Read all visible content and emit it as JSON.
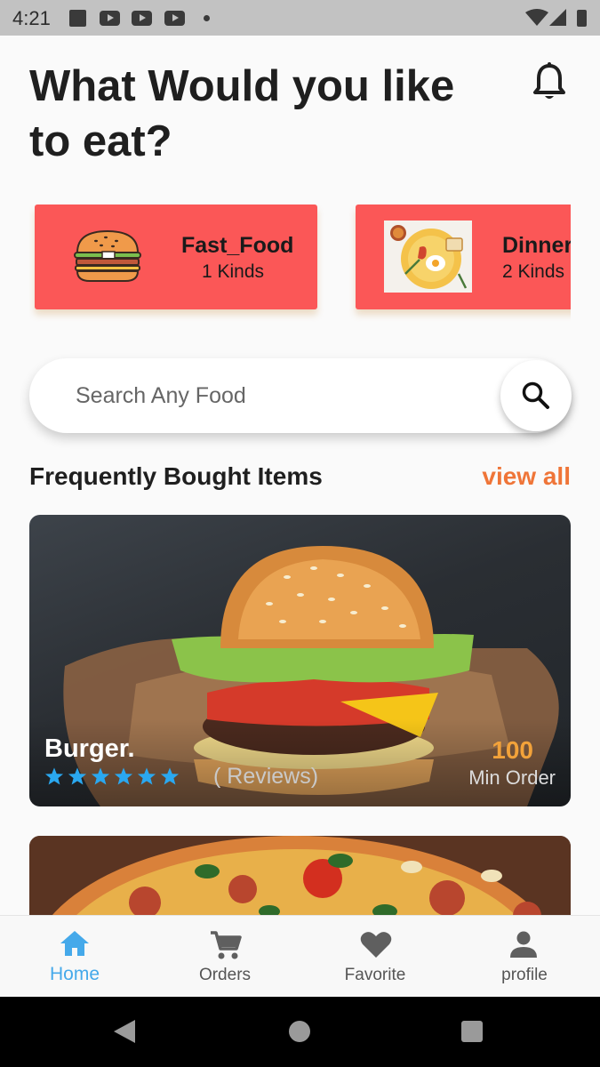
{
  "status_bar": {
    "time": "4:21",
    "icons": [
      "notification-square-icon",
      "youtube-icon",
      "youtube-icon",
      "youtube-icon",
      "dot-icon",
      "wifi-icon",
      "signal-icon",
      "battery-icon"
    ]
  },
  "header": {
    "title": "What Would you like to eat?",
    "bell_icon": "bell-icon"
  },
  "categories": [
    {
      "name": "Fast_Food",
      "count": "1 Kinds",
      "icon": "burger-icon"
    },
    {
      "name": "Dinner",
      "count": "2 Kinds",
      "icon": "breakfast-plate-image"
    }
  ],
  "search": {
    "placeholder": "Search Any Food",
    "value": "",
    "button_icon": "search-icon"
  },
  "section": {
    "title": "Frequently Bought Items",
    "view_all": "view all"
  },
  "items": [
    {
      "name": "Burger.",
      "rating_stars": 6,
      "reviews": "( Reviews)",
      "min_order_value": "100",
      "min_order_label": "Min Order"
    },
    {
      "name": "",
      "image": "pizza-image"
    }
  ],
  "bottom_nav": [
    {
      "label": "Home",
      "icon": "home-icon",
      "active": true
    },
    {
      "label": "Orders",
      "icon": "cart-icon",
      "active": false
    },
    {
      "label": "Favorite",
      "icon": "heart-icon",
      "active": false
    },
    {
      "label": "profile",
      "icon": "person-icon",
      "active": false
    }
  ],
  "colors": {
    "category_card": "#fb5757",
    "accent_orange": "#ef7538",
    "active_nav": "#45a9ea",
    "star": "#2aa8f0",
    "min_order_value": "#f2a23a"
  }
}
